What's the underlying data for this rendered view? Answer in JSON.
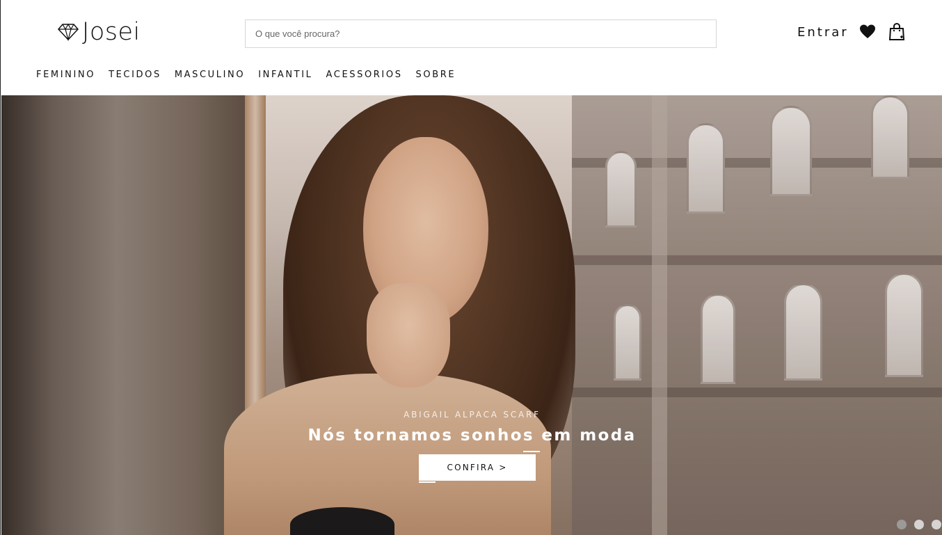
{
  "header": {
    "logo_text": "Josei",
    "logo_icon": "diamond-icon",
    "search_placeholder": "O que você procura?",
    "login_label": "Entrar",
    "wishlist_icon": "heart-icon",
    "cart_icon": "shopping-bag-icon"
  },
  "nav": {
    "items": [
      {
        "label": "FEMININO"
      },
      {
        "label": "TECIDOS"
      },
      {
        "label": "MASCULINO"
      },
      {
        "label": "INFANTIL"
      },
      {
        "label": "ACESSORIOS"
      },
      {
        "label": "SOBRE"
      }
    ]
  },
  "hero": {
    "subtitle": "ABIGAIL ALPACA SCARF",
    "title": "Nós tornamos sonhos em moda",
    "cta_label": "CONFIRA >",
    "slides_count": 3,
    "active_slide": 1
  },
  "colors": {
    "text": "#111111",
    "background": "#ffffff",
    "search_border": "#d6d6d6"
  }
}
